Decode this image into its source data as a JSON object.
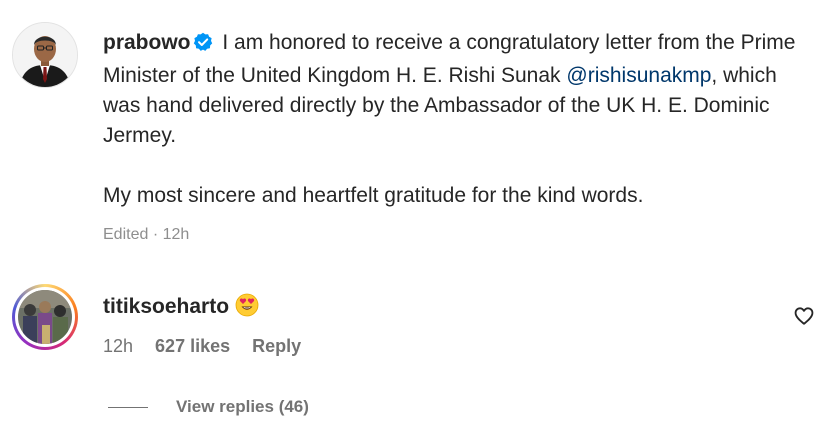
{
  "caption": {
    "username": "prabowo",
    "verified_icon": "verified-badge-icon",
    "text_before_mention": "I am honored to receive a congratulatory letter from the Prime Minister of the United Kingdom H. E. Rishi Sunak",
    "mention": "@rishisunakmp",
    "text_after_mention": ", which was hand delivered directly by the Ambassador of the UK H. E. Dominic Jermey.",
    "paragraph2": "My most sincere and heartfelt gratitude for the kind words.",
    "edited_label": "Edited",
    "separator": "·",
    "timestamp": "12h"
  },
  "comment": {
    "username": "titiksoeharto",
    "emoji_icon": "heart-eyes-emoji-icon",
    "time": "12h",
    "likes": "627 likes",
    "reply_label": "Reply",
    "like_icon": "heart-outline-icon",
    "view_replies": "View replies (46)"
  },
  "colors": {
    "text": "#262626",
    "muted": "#8e8e8e",
    "mention": "#00376b",
    "verified": "#0095f6"
  }
}
